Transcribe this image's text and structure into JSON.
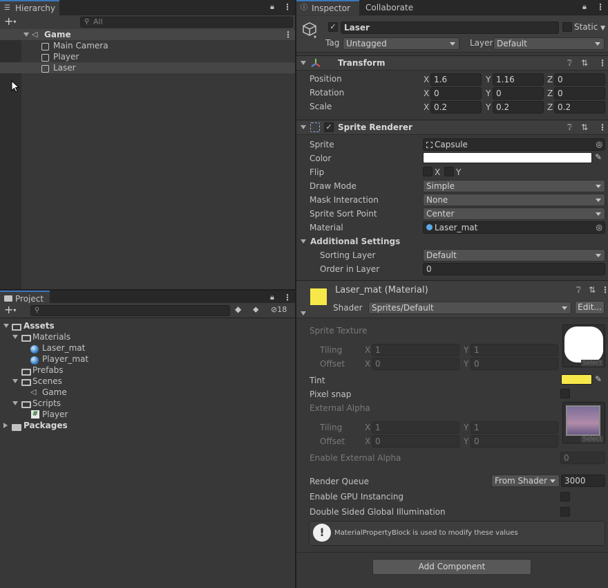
{
  "hierarchy": {
    "tab_label": "Hierarchy",
    "search_placeholder": "All",
    "scene": "Game",
    "items": [
      "Main Camera",
      "Player",
      "Laser"
    ]
  },
  "project": {
    "tab_label": "Project",
    "hidden_count": "18",
    "tree": {
      "assets": "Assets",
      "materials": "Materials",
      "laser_mat": "Laser_mat",
      "player_mat": "Player_mat",
      "prefabs": "Prefabs",
      "scenes": "Scenes",
      "game_scene": "Game",
      "scripts": "Scripts",
      "player_script": "Player",
      "packages": "Packages"
    }
  },
  "inspector": {
    "tab_label": "Inspector",
    "tab2_label": "Collaborate",
    "object_name": "Laser",
    "static_label": "Static",
    "tag_label": "Tag",
    "tag_value": "Untagged",
    "layer_label": "Layer",
    "layer_value": "Default",
    "transform": {
      "title": "Transform",
      "position_label": "Position",
      "rotation_label": "Rotation",
      "scale_label": "Scale",
      "position": {
        "x": "1.6",
        "y": "1.16",
        "z": "0"
      },
      "rotation": {
        "x": "0",
        "y": "0",
        "z": "0"
      },
      "scale": {
        "x": "0.2",
        "y": "0.2",
        "z": "0.2"
      },
      "axis_x": "X",
      "axis_y": "Y",
      "axis_z": "Z"
    },
    "sprite_renderer": {
      "title": "Sprite Renderer",
      "sprite_label": "Sprite",
      "sprite_value": "Capsule",
      "color_label": "Color",
      "color_value": "#ffffff",
      "flip_label": "Flip",
      "flip_x": "X",
      "flip_y": "Y",
      "draw_mode_label": "Draw Mode",
      "draw_mode_value": "Simple",
      "mask_label": "Mask Interaction",
      "mask_value": "None",
      "sort_point_label": "Sprite Sort Point",
      "sort_point_value": "Center",
      "material_label": "Material",
      "material_value": "Laser_mat",
      "additional_label": "Additional Settings",
      "sorting_layer_label": "Sorting Layer",
      "sorting_layer_value": "Default",
      "order_label": "Order in Layer",
      "order_value": "0"
    },
    "material": {
      "title": "Laser_mat (Material)",
      "swatch_color": "#f7e84a",
      "shader_label": "Shader",
      "shader_value": "Sprites/Default",
      "edit_label": "Edit...",
      "sprite_texture_label": "Sprite Texture",
      "tiling_label": "Tiling",
      "offset_label": "Offset",
      "tiling_x": "1",
      "tiling_y": "1",
      "offset_x": "0",
      "offset_y": "0",
      "select_label": "Select",
      "tint_label": "Tint",
      "tint_color": "#f7e84a",
      "pixel_snap_label": "Pixel snap",
      "external_alpha_label": "External Alpha",
      "ea_tiling_x": "1",
      "ea_tiling_y": "1",
      "ea_offset_x": "0",
      "ea_offset_y": "0",
      "enable_ext_alpha_label": "Enable External Alpha",
      "enable_ext_alpha_value": "0",
      "render_queue_label": "Render Queue",
      "render_queue_mode": "From Shader",
      "render_queue_value": "3000",
      "gpu_instancing_label": "Enable GPU Instancing",
      "double_sided_label": "Double Sided Global Illumination",
      "info_message": "MaterialPropertyBlock is used to modify these values"
    },
    "add_component_label": "Add Component"
  },
  "colors": {
    "accent": "#3a79bb",
    "selection": "#4d4d4d",
    "tint": "#f7e84a"
  }
}
